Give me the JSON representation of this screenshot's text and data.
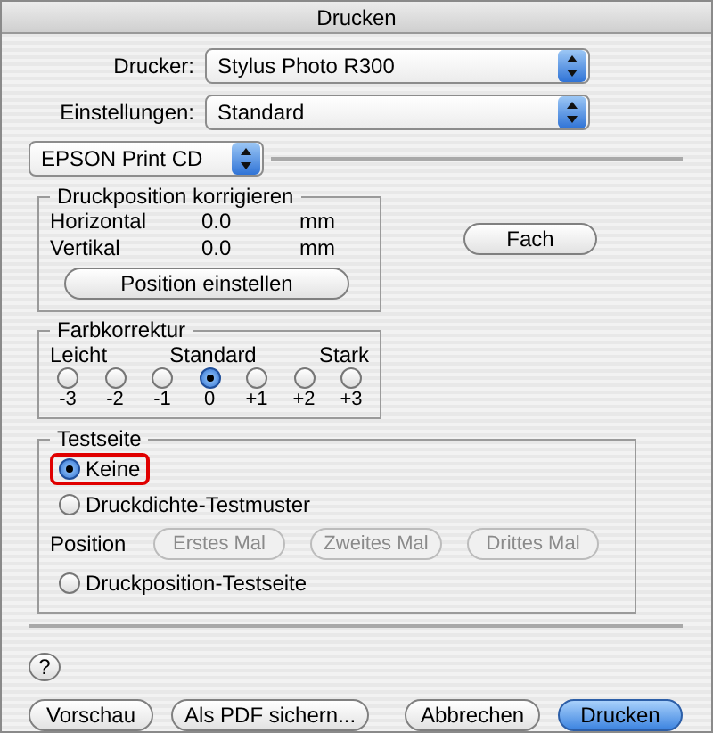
{
  "window": {
    "title": "Drucken"
  },
  "printer": {
    "label": "Drucker:",
    "value": "Stylus Photo R300"
  },
  "presets": {
    "label": "Einstellungen:",
    "value": "Standard"
  },
  "panel": {
    "value": "EPSON Print CD"
  },
  "print_position": {
    "title": "Druckposition korrigieren",
    "rows": [
      {
        "label": "Horizontal",
        "value": "0.0",
        "unit": "mm"
      },
      {
        "label": "Vertikal",
        "value": "0.0",
        "unit": "mm"
      }
    ],
    "button": "Position einstellen"
  },
  "tray_button": "Fach",
  "color_correction": {
    "title": "Farbkorrektur",
    "scale_labels": [
      "Leicht",
      "Standard",
      "Stark"
    ],
    "options": [
      {
        "label": "-3",
        "selected": false
      },
      {
        "label": "-2",
        "selected": false
      },
      {
        "label": "-1",
        "selected": false
      },
      {
        "label": "0",
        "selected": true
      },
      {
        "label": "+1",
        "selected": false
      },
      {
        "label": "+2",
        "selected": false
      },
      {
        "label": "+3",
        "selected": false
      }
    ]
  },
  "test_page": {
    "title": "Testseite",
    "items": [
      {
        "kind": "radio",
        "label": "Keine",
        "selected": true,
        "highlighted": true
      },
      {
        "kind": "radio",
        "label": "Druckdichte-Testmuster",
        "selected": false,
        "highlighted": false
      },
      {
        "kind": "buttons",
        "label": "Position",
        "buttons": [
          {
            "label": "Erstes Mal",
            "disabled": true
          },
          {
            "label": "Zweites Mal",
            "disabled": true
          },
          {
            "label": "Drittes Mal",
            "disabled": true
          }
        ]
      },
      {
        "kind": "radio",
        "label": "Druckposition-Testseite",
        "selected": false,
        "highlighted": false
      }
    ]
  },
  "help_button": "?",
  "buttons": [
    {
      "label": "Vorschau",
      "default": false
    },
    {
      "label": "Als PDF sichern...",
      "default": false
    },
    {
      "label": "Abbrechen",
      "default": false
    },
    {
      "label": "Drucken",
      "default": true
    }
  ]
}
